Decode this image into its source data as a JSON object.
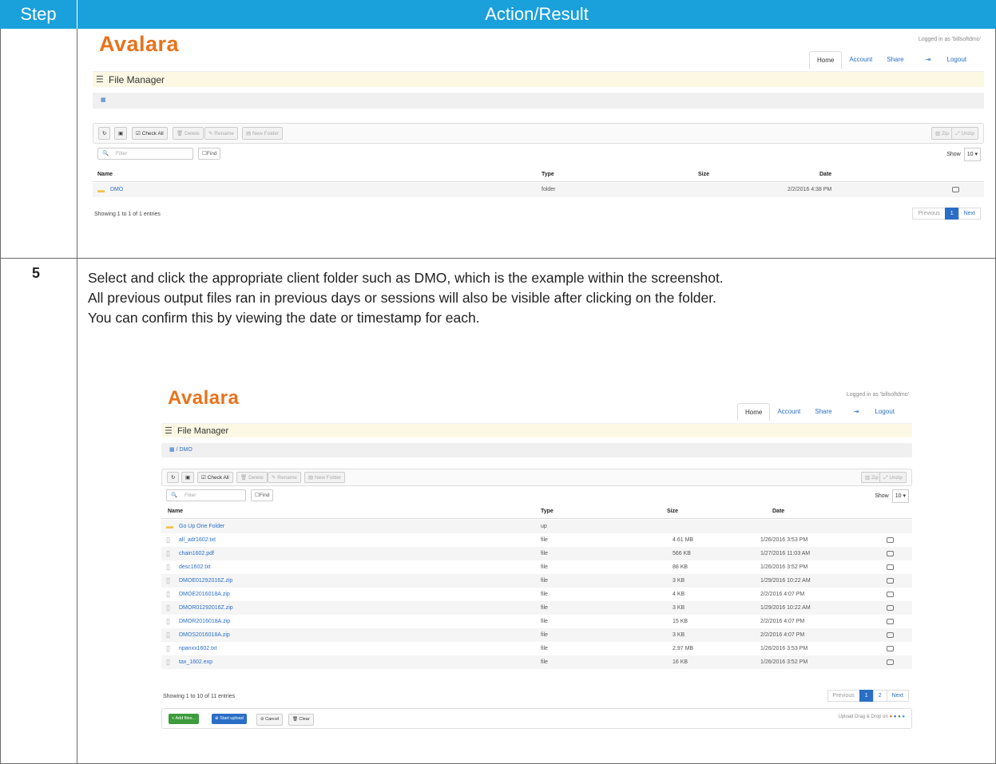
{
  "header": {
    "step": "Step",
    "action": "Action/Result"
  },
  "step5": {
    "number": "5",
    "lines": [
      "Select and click the appropriate client folder such as DMO, which is the example within the screenshot.",
      "All previous output files ran in previous days or sessions will also be visible after clicking on the folder.",
      "You can confirm this by viewing the date or timestamp for each."
    ]
  },
  "app": {
    "logo": "Avalara",
    "logged_in": "Logged in as 'billsoftdmo'",
    "nav": [
      "Home",
      "Account",
      "Share",
      "Logout"
    ],
    "title": "File Manager",
    "toolbar": [
      "Check All",
      "Delete",
      "Rename",
      "New Folder"
    ],
    "right_tools": [
      "Zip",
      "Unzip"
    ],
    "filter_placeholder": "Filter",
    "find_label": "Find",
    "show_label": "Show",
    "show_value": "10",
    "columns": [
      "Name",
      "Type",
      "Size",
      "Date"
    ],
    "pager": {
      "prev": "Previous",
      "next": "Next"
    }
  },
  "shot1": {
    "rows": [
      {
        "name": "DMO",
        "type": "folder",
        "size": "",
        "date": "2/2/2016 4:38 PM"
      }
    ],
    "showing": "Showing 1 to 1 of 1 entries",
    "pages": [
      "1"
    ]
  },
  "shot2": {
    "breadcrumb": "DMO",
    "rows": [
      {
        "name": "Go Up One Folder",
        "type": "up",
        "size": "",
        "date": ""
      },
      {
        "name": "all_adr1602.txt",
        "type": "file",
        "size": "4.61 MB",
        "date": "1/26/2016 3:53 PM"
      },
      {
        "name": "chain1602.pdf",
        "type": "file",
        "size": "566 KB",
        "date": "1/27/2016 11:03 AM"
      },
      {
        "name": "desc1602.txt",
        "type": "file",
        "size": "88 KB",
        "date": "1/26/2016 3:52 PM"
      },
      {
        "name": "DMOE01292016Z.zip",
        "type": "file",
        "size": "3 KB",
        "date": "1/29/2016 10:22 AM"
      },
      {
        "name": "DMOE2016018A.zip",
        "type": "file",
        "size": "4 KB",
        "date": "2/2/2016 4:07 PM"
      },
      {
        "name": "DMOR01292016Z.zip",
        "type": "file",
        "size": "3 KB",
        "date": "1/29/2016 10:22 AM"
      },
      {
        "name": "DMOR2016018A.zip",
        "type": "file",
        "size": "15 KB",
        "date": "2/2/2016 4:07 PM"
      },
      {
        "name": "DMOS2016018A.zip",
        "type": "file",
        "size": "3 KB",
        "date": "2/2/2016 4:07 PM"
      },
      {
        "name": "npanxx1602.txt",
        "type": "file",
        "size": "2.97 MB",
        "date": "1/26/2016 3:53 PM"
      },
      {
        "name": "tax_1602.exp",
        "type": "file",
        "size": "16 KB",
        "date": "1/26/2016 3:52 PM"
      }
    ],
    "showing": "Showing 1 to 10 of 11 entries",
    "pages": [
      "1",
      "2"
    ],
    "upload_buttons": [
      "Add files...",
      "Start upload",
      "Cancel",
      "Clear"
    ],
    "dragdrop": "Upload Drag & Drop on"
  }
}
